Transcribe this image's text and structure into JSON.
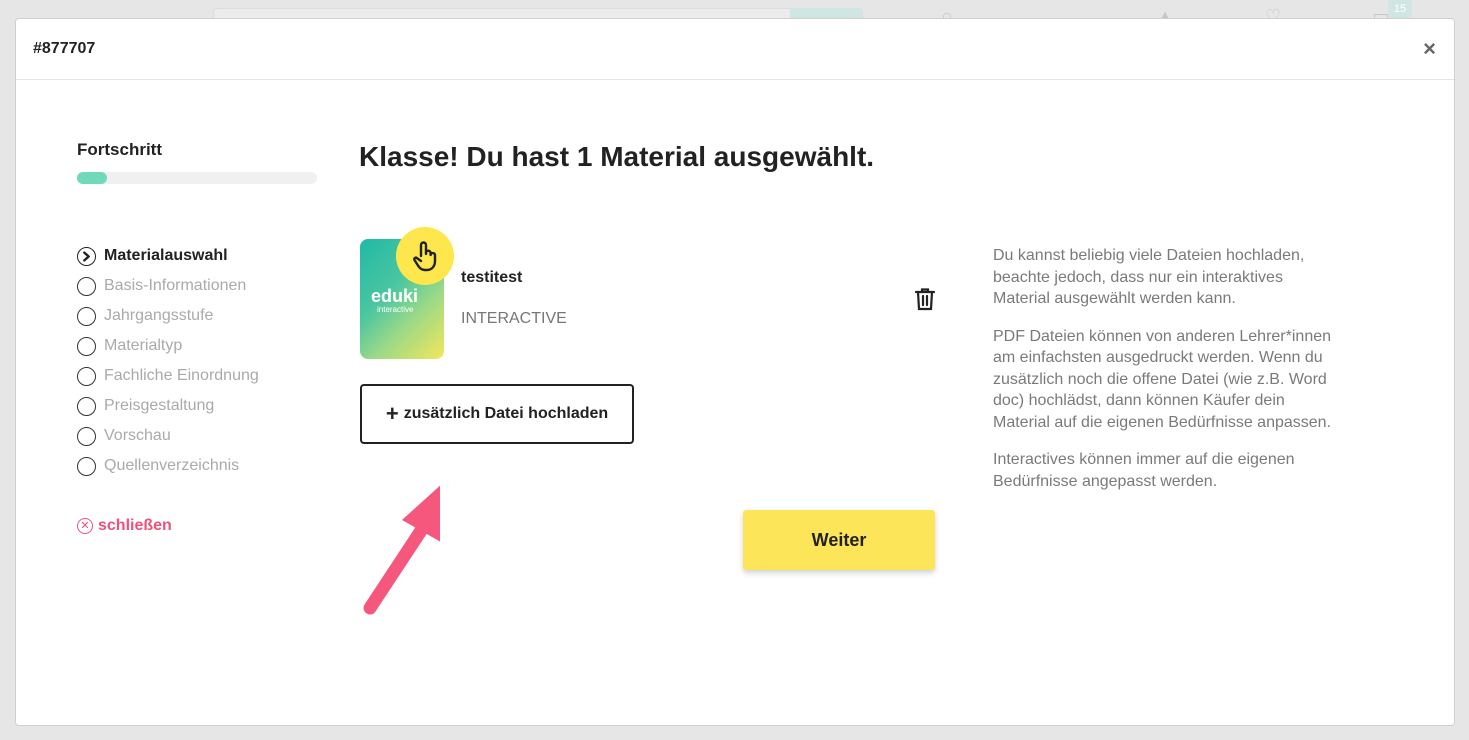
{
  "background": {
    "cart_count": "15"
  },
  "modal": {
    "id_label": "#877707",
    "close_glyph": "×"
  },
  "sidebar": {
    "progress_title": "Fortschritt",
    "progress_fraction": 0.125,
    "steps": [
      {
        "label": "Materialauswahl",
        "active": true
      },
      {
        "label": "Basis-Informationen",
        "active": false
      },
      {
        "label": "Jahrgangsstufe",
        "active": false
      },
      {
        "label": "Materialtyp",
        "active": false
      },
      {
        "label": "Fachliche Einordnung",
        "active": false
      },
      {
        "label": "Preisgestaltung",
        "active": false
      },
      {
        "label": "Vorschau",
        "active": false
      },
      {
        "label": "Quellenverzeichnis",
        "active": false
      }
    ],
    "close_label": "schließen"
  },
  "main": {
    "title": "Klasse! Du hast 1 Material ausgewählt.",
    "item": {
      "thumb_logo": "eduki",
      "thumb_sub": "interactive",
      "name": "testitest",
      "type": "INTERACTIVE"
    },
    "upload_label": "zusätzlich Datei hochladen",
    "next_label": "Weiter"
  },
  "info": {
    "paragraphs": [
      "Du kannst beliebig viele Dateien hochladen, beachte jedoch, dass nur ein interaktives Material ausgewählt werden kann.",
      "PDF Dateien können von anderen Lehrer*innen am einfachsten ausgedruckt werden. Wenn du zusätzlich noch die offene Datei (wie z.B. Word doc) hochlädst, dann können Käufer dein Material auf die eigenen Bedürfnisse anpassen.",
      "Interactives können immer auf die eigenen Bedürfnisse angepasst werden."
    ]
  },
  "colors": {
    "accent_pink": "#f0517a",
    "progress_green": "#6fdab9",
    "button_yellow": "#fde55a"
  }
}
